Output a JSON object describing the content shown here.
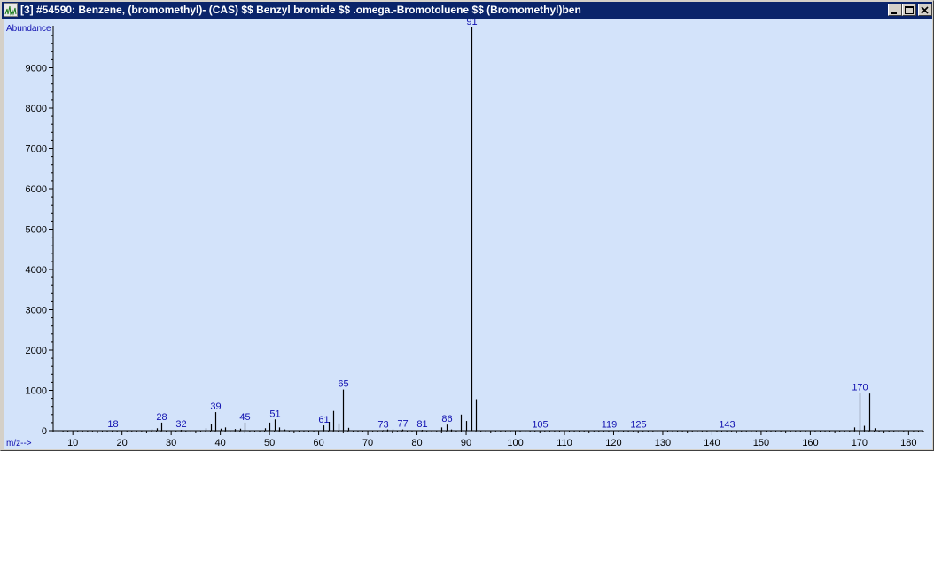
{
  "window": {
    "title": "[3] #54590: Benzene, (bromomethyl)- (CAS) $$ Benzyl bromide $$ .omega.-Bromotoluene $$ (Bromomethyl)ben",
    "buttons": [
      "minimize",
      "maximize",
      "close"
    ]
  },
  "colors": {
    "titlebar": "#0a246a",
    "plot_background": "#d3e3fa",
    "peak_label": "#1010b0",
    "axis": "#000000"
  },
  "chart_data": {
    "type": "bar",
    "ylabel": "Abundance",
    "xlabel": "m/z-->",
    "xlim": [
      6,
      183
    ],
    "ylim": [
      0,
      10000
    ],
    "x_ticks": [
      10,
      20,
      30,
      40,
      50,
      60,
      70,
      80,
      90,
      100,
      110,
      120,
      130,
      140,
      150,
      160,
      170,
      180
    ],
    "y_ticks": [
      0,
      1000,
      2000,
      3000,
      4000,
      5000,
      6000,
      7000,
      8000,
      9000
    ],
    "peaks": [
      {
        "mz": 18,
        "abundance": 20,
        "label": "18"
      },
      {
        "mz": 26,
        "abundance": 30
      },
      {
        "mz": 27,
        "abundance": 60
      },
      {
        "mz": 28,
        "abundance": 200,
        "label": "28"
      },
      {
        "mz": 32,
        "abundance": 20,
        "label": "32"
      },
      {
        "mz": 37,
        "abundance": 60
      },
      {
        "mz": 38,
        "abundance": 160
      },
      {
        "mz": 39,
        "abundance": 460,
        "label": "39"
      },
      {
        "mz": 40,
        "abundance": 50
      },
      {
        "mz": 41,
        "abundance": 80
      },
      {
        "mz": 43,
        "abundance": 40
      },
      {
        "mz": 44,
        "abundance": 50
      },
      {
        "mz": 45,
        "abundance": 200,
        "label": "45"
      },
      {
        "mz": 49,
        "abundance": 60
      },
      {
        "mz": 50,
        "abundance": 200
      },
      {
        "mz": 51,
        "abundance": 280,
        "label": "51"
      },
      {
        "mz": 52,
        "abundance": 80
      },
      {
        "mz": 53,
        "abundance": 30
      },
      {
        "mz": 61,
        "abundance": 130,
        "label": "61"
      },
      {
        "mz": 62,
        "abundance": 220
      },
      {
        "mz": 63,
        "abundance": 490
      },
      {
        "mz": 64,
        "abundance": 180
      },
      {
        "mz": 65,
        "abundance": 1020,
        "label": "65"
      },
      {
        "mz": 66,
        "abundance": 70
      },
      {
        "mz": 73,
        "abundance": 15,
        "label": "73"
      },
      {
        "mz": 74,
        "abundance": 30
      },
      {
        "mz": 75,
        "abundance": 30
      },
      {
        "mz": 77,
        "abundance": 30,
        "label": "77"
      },
      {
        "mz": 81,
        "abundance": 20,
        "label": "81"
      },
      {
        "mz": 85,
        "abundance": 80
      },
      {
        "mz": 86,
        "abundance": 150,
        "label": "86"
      },
      {
        "mz": 87,
        "abundance": 30
      },
      {
        "mz": 89,
        "abundance": 400
      },
      {
        "mz": 90,
        "abundance": 240
      },
      {
        "mz": 91,
        "abundance": 9999,
        "label": "91"
      },
      {
        "mz": 92,
        "abundance": 780
      },
      {
        "mz": 105,
        "abundance": 10,
        "label": "105"
      },
      {
        "mz": 119,
        "abundance": 10,
        "label": "119"
      },
      {
        "mz": 125,
        "abundance": 10,
        "label": "125"
      },
      {
        "mz": 143,
        "abundance": 10,
        "label": "143"
      },
      {
        "mz": 169,
        "abundance": 80
      },
      {
        "mz": 170,
        "abundance": 930,
        "label": "170"
      },
      {
        "mz": 171,
        "abundance": 120
      },
      {
        "mz": 172,
        "abundance": 920
      },
      {
        "mz": 173,
        "abundance": 60
      }
    ]
  }
}
